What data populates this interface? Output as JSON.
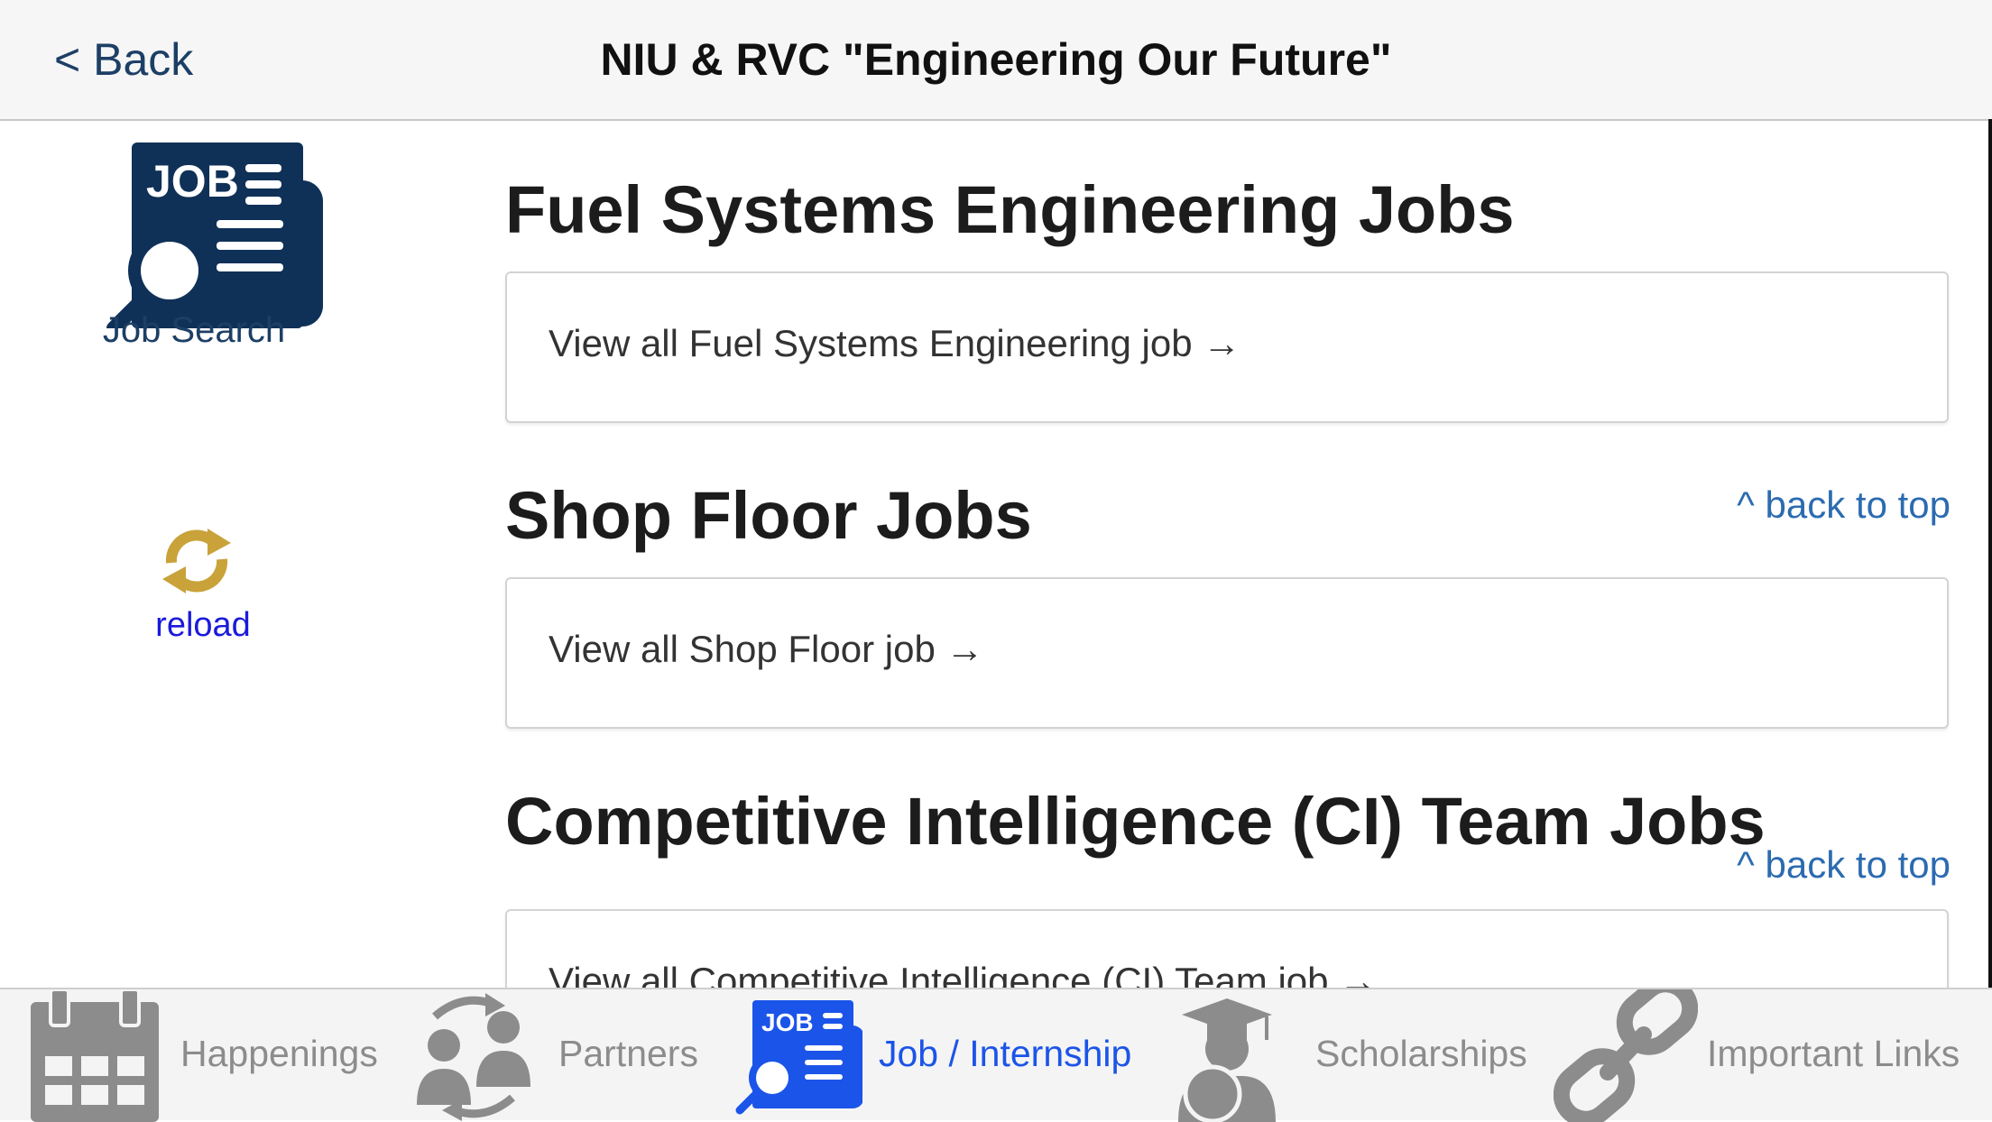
{
  "navbar": {
    "back_label": "< Back",
    "title": "NIU & RVC \"Engineering Our Future\""
  },
  "sidebar": {
    "logo_text": "JOB",
    "job_search_label": "Job Search",
    "reload_label": "reload"
  },
  "sections": [
    {
      "title": "Fuel Systems Engineering Jobs",
      "link_text": "View all Fuel Systems Engineering job →"
    },
    {
      "title": "Shop Floor Jobs",
      "link_text": "View all Shop Floor job →",
      "back_to_top": "^ back to top"
    },
    {
      "title": "Competitive Intelligence (CI) Team Jobs",
      "link_text": "View all Competitive Intelligence (CI) Team job →",
      "back_to_top": "^ back to top"
    }
  ],
  "tabs": [
    {
      "label": "Happenings",
      "icon": "calendar-icon",
      "active": false
    },
    {
      "label": "Partners",
      "icon": "partners-icon",
      "active": false
    },
    {
      "label": "Job / Internship",
      "icon": "job-search-icon",
      "active": true
    },
    {
      "label": "Scholarships",
      "icon": "graduate-icon",
      "active": false
    },
    {
      "label": "Important Links",
      "icon": "link-icon",
      "active": false
    }
  ],
  "colors": {
    "nav_text": "#1d3f66",
    "link_blue": "#2c6bb0",
    "tab_active": "#1b54e8",
    "tab_inactive": "#8c8c8c",
    "reload_gold": "#c9a23a"
  }
}
